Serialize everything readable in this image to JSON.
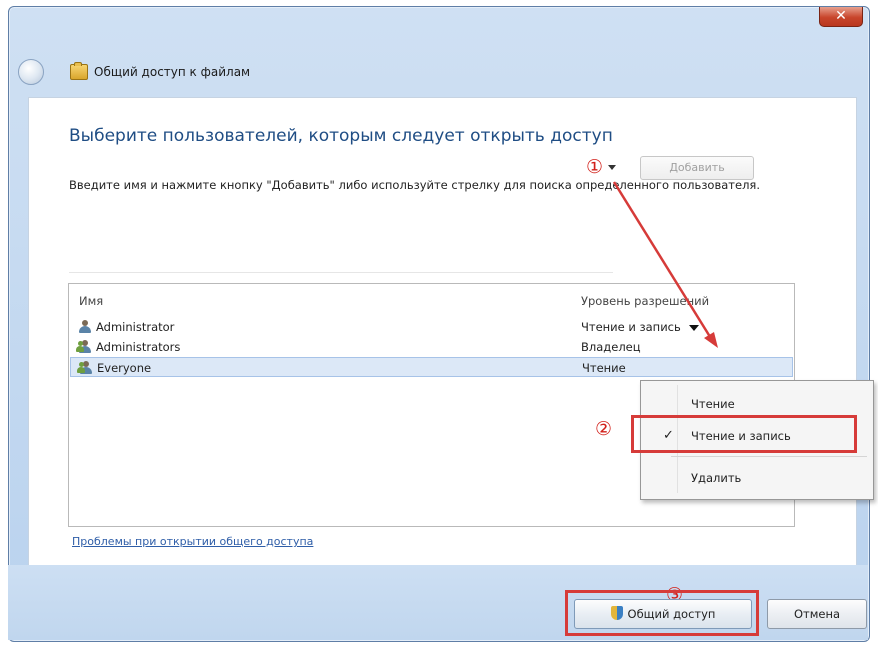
{
  "window": {
    "title": "Общий доступ к файлам",
    "close_label": "✕"
  },
  "main": {
    "heading": "Выберите пользователей, которым следует открыть доступ",
    "instruction": "Введите имя и нажмите кнопку \"Добавить\" либо используйте стрелку для поиска определенного пользователя.",
    "input_value": "",
    "add_label": "Добавить"
  },
  "list": {
    "columns": {
      "name": "Имя",
      "level": "Уровень разрешений"
    },
    "rows": [
      {
        "name": "Administrator",
        "level": "Чтение и запись",
        "icon": "user-icon"
      },
      {
        "name": "Administrators",
        "level": "Владелец",
        "icon": "group-icon"
      },
      {
        "name": "Everyone",
        "level": "Чтение",
        "icon": "group-icon"
      }
    ]
  },
  "menu": {
    "items": [
      {
        "label": "Чтение",
        "checked": false
      },
      {
        "label": "Чтение и запись",
        "checked": true,
        "check": "✓"
      },
      {
        "label": "Удалить",
        "checked": false
      }
    ]
  },
  "annotations": {
    "step1": "①",
    "step2": "②",
    "step3": "③",
    "color": "#d63b39"
  },
  "links": {
    "problem": "Проблемы при открытии общего доступа"
  },
  "footer": {
    "share_label": "Общий доступ",
    "cancel_label": "Отмена"
  }
}
